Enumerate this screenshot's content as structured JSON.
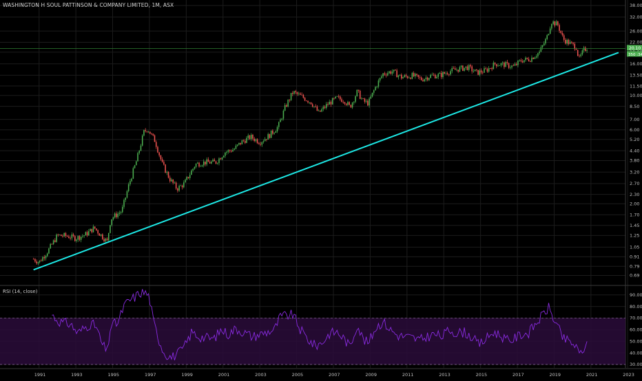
{
  "title": "WASHINGTON H SOUL PATTINSON & COMPANY LIMITED, 1M, ASX",
  "rsi_title": "RSI (14, close)",
  "price_badge": "20.10",
  "time_badge": "350 :34",
  "colors": {
    "background": "#000000",
    "up": "#26a69a",
    "up_bright": "#4caf50",
    "down": "#ef5350",
    "trendline": "#1de9e6",
    "rsi_line": "#8a2be2",
    "rsi_band": "#2a0c3a",
    "grid": "#1c1c1c",
    "axis_text": "#c0c0c0",
    "badge": "#4caf50"
  },
  "chart_data": [
    {
      "type": "candlestick",
      "scale": "log",
      "x_ticks": [
        "1991",
        "1993",
        "1995",
        "1997",
        "1999",
        "2001",
        "2003",
        "2005",
        "2007",
        "2009",
        "2011",
        "2013",
        "2015",
        "2017",
        "2019",
        "2021",
        "2023"
      ],
      "y_ticks": [
        38.0,
        32.0,
        26.0,
        22.0,
        19.0,
        16.0,
        13.5,
        11.5,
        10.0,
        8.5,
        7.0,
        6.0,
        5.2,
        4.4,
        3.8,
        3.2,
        2.7,
        2.3,
        2.0,
        1.7,
        1.45,
        1.25,
        1.05,
        0.91,
        0.79,
        0.69
      ],
      "ylim": [
        0.62,
        40
      ],
      "xlim": [
        1990.0,
        2024.0
      ],
      "last_price": 20.1,
      "anchors": [
        [
          1990.7,
          0.88
        ],
        [
          1991.0,
          0.84
        ],
        [
          1991.5,
          1.0
        ],
        [
          1992.0,
          1.25
        ],
        [
          1992.5,
          1.24
        ],
        [
          1993.0,
          1.2
        ],
        [
          1993.5,
          1.26
        ],
        [
          1994.0,
          1.4
        ],
        [
          1994.3,
          1.28
        ],
        [
          1994.7,
          1.14
        ],
        [
          1994.9,
          1.6
        ],
        [
          1995.5,
          1.8
        ],
        [
          1995.9,
          2.7
        ],
        [
          1996.3,
          3.8
        ],
        [
          1996.7,
          5.8
        ],
        [
          1996.9,
          6.1
        ],
        [
          1997.3,
          5.1
        ],
        [
          1997.7,
          3.6
        ],
        [
          1998.1,
          2.9
        ],
        [
          1998.5,
          2.5
        ],
        [
          1998.9,
          2.7
        ],
        [
          1999.5,
          3.6
        ],
        [
          2000.0,
          3.7
        ],
        [
          2000.6,
          3.7
        ],
        [
          2001.1,
          4.3
        ],
        [
          2001.6,
          4.5
        ],
        [
          2002.0,
          5.0
        ],
        [
          2002.5,
          5.4
        ],
        [
          2003.0,
          5.0
        ],
        [
          2003.5,
          5.5
        ],
        [
          2004.0,
          6.3
        ],
        [
          2004.4,
          8.5
        ],
        [
          2004.8,
          10.5
        ],
        [
          2005.3,
          9.8
        ],
        [
          2005.8,
          9.0
        ],
        [
          2006.2,
          7.7
        ],
        [
          2006.7,
          8.8
        ],
        [
          2007.2,
          9.6
        ],
        [
          2007.6,
          9.3
        ],
        [
          2007.9,
          8.4
        ],
        [
          2008.3,
          10.6
        ],
        [
          2008.6,
          9.2
        ],
        [
          2008.9,
          8.9
        ],
        [
          2009.3,
          11.4
        ],
        [
          2009.7,
          13.8
        ],
        [
          2010.2,
          14.3
        ],
        [
          2010.7,
          13.1
        ],
        [
          2011.3,
          13.4
        ],
        [
          2011.8,
          12.7
        ],
        [
          2012.3,
          13.4
        ],
        [
          2012.8,
          13.5
        ],
        [
          2013.3,
          14.3
        ],
        [
          2013.8,
          14.8
        ],
        [
          2014.3,
          15.2
        ],
        [
          2014.8,
          14.0
        ],
        [
          2015.3,
          14.5
        ],
        [
          2015.8,
          16.0
        ],
        [
          2016.3,
          15.8
        ],
        [
          2016.8,
          15.3
        ],
        [
          2017.2,
          16.8
        ],
        [
          2017.7,
          17.2
        ],
        [
          2018.2,
          19.0
        ],
        [
          2018.6,
          23.5
        ],
        [
          2018.85,
          30.0
        ],
        [
          2019.2,
          28.5
        ],
        [
          2019.5,
          23.0
        ],
        [
          2019.9,
          21.5
        ],
        [
          2020.2,
          20.5
        ],
        [
          2020.35,
          17.0
        ],
        [
          2020.6,
          19.5
        ],
        [
          2020.8,
          20.3
        ]
      ],
      "trendline": {
        "from": [
          1990.7,
          0.75
        ],
        "to": [
          2022.5,
          18.9
        ]
      }
    },
    {
      "type": "line",
      "name": "RSI",
      "ylim": [
        27,
        97
      ],
      "y_ticks": [
        90.0,
        80.0,
        70.0,
        60.0,
        50.0,
        40.0,
        30.0
      ],
      "bands": [
        30,
        70
      ],
      "anchors": [
        [
          1991.7,
          73
        ],
        [
          1992.0,
          68
        ],
        [
          1992.3,
          66
        ],
        [
          1992.7,
          65
        ],
        [
          1993.1,
          57
        ],
        [
          1993.5,
          62
        ],
        [
          1993.8,
          65
        ],
        [
          1994.1,
          63
        ],
        [
          1994.4,
          48
        ],
        [
          1994.7,
          41
        ],
        [
          1994.9,
          64
        ],
        [
          1995.3,
          66
        ],
        [
          1995.6,
          80
        ],
        [
          1995.9,
          85
        ],
        [
          1996.2,
          88
        ],
        [
          1996.5,
          92
        ],
        [
          1996.8,
          92
        ],
        [
          1997.0,
          88
        ],
        [
          1997.2,
          68
        ],
        [
          1997.5,
          52
        ],
        [
          1997.8,
          40
        ],
        [
          1998.2,
          36
        ],
        [
          1998.6,
          40
        ],
        [
          1998.9,
          45
        ],
        [
          1999.3,
          58
        ],
        [
          1999.7,
          54
        ],
        [
          2000.1,
          53
        ],
        [
          2000.5,
          52
        ],
        [
          2000.9,
          60
        ],
        [
          2001.3,
          56
        ],
        [
          2001.7,
          61
        ],
        [
          2002.1,
          58
        ],
        [
          2002.6,
          54
        ],
        [
          2003.0,
          56
        ],
        [
          2003.4,
          58
        ],
        [
          2003.8,
          60
        ],
        [
          2004.1,
          71
        ],
        [
          2004.4,
          72
        ],
        [
          2004.8,
          73
        ],
        [
          2005.2,
          60
        ],
        [
          2005.6,
          52
        ],
        [
          2006.0,
          46
        ],
        [
          2006.4,
          49
        ],
        [
          2006.8,
          57
        ],
        [
          2007.2,
          58
        ],
        [
          2007.6,
          52
        ],
        [
          2007.9,
          45
        ],
        [
          2008.3,
          65
        ],
        [
          2008.6,
          52
        ],
        [
          2008.9,
          48
        ],
        [
          2009.3,
          62
        ],
        [
          2009.7,
          67
        ],
        [
          2010.1,
          60
        ],
        [
          2010.5,
          55
        ],
        [
          2010.9,
          54
        ],
        [
          2011.3,
          53
        ],
        [
          2011.7,
          51
        ],
        [
          2012.1,
          54
        ],
        [
          2012.5,
          56
        ],
        [
          2012.9,
          54
        ],
        [
          2013.3,
          60
        ],
        [
          2013.7,
          57
        ],
        [
          2014.1,
          58
        ],
        [
          2014.5,
          54
        ],
        [
          2014.9,
          47
        ],
        [
          2015.3,
          52
        ],
        [
          2015.7,
          58
        ],
        [
          2016.1,
          55
        ],
        [
          2016.5,
          50
        ],
        [
          2016.8,
          52
        ],
        [
          2017.2,
          56
        ],
        [
          2017.6,
          57
        ],
        [
          2018.0,
          65
        ],
        [
          2018.4,
          73
        ],
        [
          2018.7,
          79
        ],
        [
          2018.9,
          72
        ],
        [
          2019.2,
          62
        ],
        [
          2019.5,
          52
        ],
        [
          2019.8,
          50
        ],
        [
          2020.0,
          48
        ],
        [
          2020.2,
          45
        ],
        [
          2020.35,
          38
        ],
        [
          2020.6,
          44
        ],
        [
          2020.8,
          46
        ]
      ]
    }
  ]
}
